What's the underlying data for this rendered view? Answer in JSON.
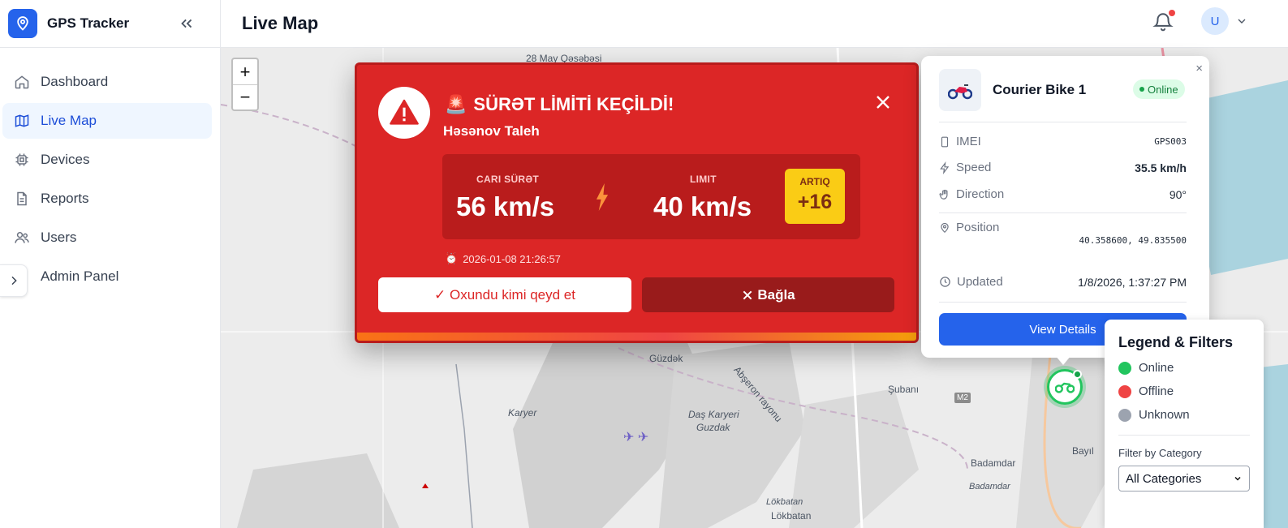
{
  "app": {
    "name": "GPS Tracker"
  },
  "sidebar": {
    "items": [
      {
        "label": "Dashboard",
        "icon": "home-icon"
      },
      {
        "label": "Live Map",
        "icon": "map-icon",
        "active": true
      },
      {
        "label": "Devices",
        "icon": "chip-icon"
      },
      {
        "label": "Reports",
        "icon": "document-icon"
      },
      {
        "label": "Users",
        "icon": "users-icon"
      },
      {
        "label": "Admin Panel",
        "icon": "chevron-right-icon"
      }
    ]
  },
  "header": {
    "title": "Live Map",
    "avatar_initial": "U",
    "has_notification": true
  },
  "map": {
    "zoom_in": "+",
    "zoom_out": "−",
    "labels": {
      "l1": "28 May Qəsəbəsi",
      "l2": "Güzdək",
      "l3": "Abşeron rayonu",
      "l4": "Şubanı",
      "l5": "Karyer",
      "l6": "Daş Karyeri",
      "l7": "Guzdak",
      "l8": "M2",
      "l9": "Bayıl",
      "l10": "Badamdar",
      "l11": "Badamdar",
      "l12": "Lökbatan",
      "l13": "Lökbatan"
    }
  },
  "alert": {
    "emoji": "🚨",
    "title": "SÜRƏT LİMİTİ KEÇİLDİ!",
    "driver": "Həsənov Taleh",
    "current_label": "CARI SÜRƏT",
    "current_value": "56 km/s",
    "limit_label": "LIMIT",
    "limit_value": "40 km/s",
    "excess_label": "ARTIQ",
    "excess_value": "+16",
    "time_emoji": "⏰",
    "time": "2026-01-08 21:26:57",
    "ack_button": "✓ Oxundu kimi qeyd et",
    "close_button": "Bağla",
    "colors": {
      "bg": "#dc2626",
      "panel": "#b91c1c",
      "excess": "#facc15"
    }
  },
  "device": {
    "name": "Courier Bike 1",
    "status": "Online",
    "imei_label": "IMEI",
    "imei": "GPS003",
    "speed_label": "Speed",
    "speed": "35.5 km/h",
    "direction_label": "Direction",
    "direction": "90°",
    "position_label": "Position",
    "position": "40.358600, 49.835500",
    "updated_label": "Updated",
    "updated": "1/8/2026, 1:37:27 PM",
    "view_details": "View Details",
    "close": "×"
  },
  "legend": {
    "title": "Legend & Filters",
    "items": [
      {
        "label": "Online",
        "color": "#22c55e"
      },
      {
        "label": "Offline",
        "color": "#ef4444"
      },
      {
        "label": "Unknown",
        "color": "#9ca3af"
      }
    ],
    "filter_label": "Filter by Category",
    "filter_value": "All Categories"
  }
}
